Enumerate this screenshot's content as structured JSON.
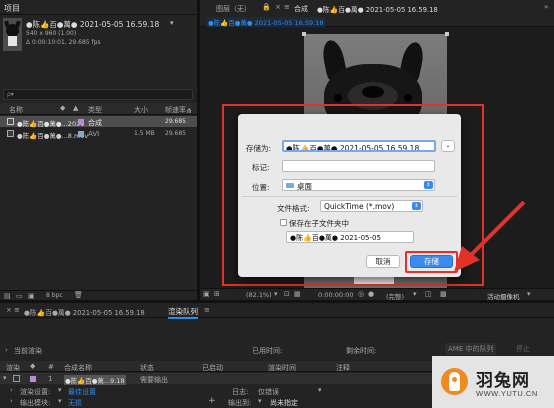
{
  "project_panel": {
    "tab_label": "项目",
    "comp_name": "●陈👍百●萬● 2021-05-05 16.59.18",
    "comp_name_arrow": "▾",
    "comp_info_size": "540 x 960 (1.00)",
    "comp_info_duration": "Δ 0:00:10:01, 29.685 fps",
    "search_placeholder": "ρ▾",
    "columns": {
      "name": "名称",
      "type": "类型",
      "size": "大小",
      "fps": "帧速率"
    },
    "items": [
      {
        "name": "●陈👍百●萬●...2021",
        "type": "合成",
        "size": "",
        "fps": "29.685"
      },
      {
        "name": "●陈👍百●萬●...8.mov",
        "type": "AVI",
        "size": "1.5 MB",
        "fps": "29.685"
      }
    ],
    "bpc": "8 bpc"
  },
  "viewer": {
    "tab_layer": "图层（无）",
    "tab_comp_prefix": "合成",
    "tab_comp_name": "●陈👍百●萬● 2021-05-05 16.59.18",
    "sub_tab": "●陈👍百●萬● 2021-05-05 16.59.18",
    "zoom": "(82.1%)",
    "timecode": "0:00:00:00",
    "resolution": "(完整)",
    "camera": "活动摄像机"
  },
  "save_dialog": {
    "save_as_label": "存储为:",
    "save_as_value": "●陈👍百●萬● 2021-05-05 16.59.18",
    "tags_label": "标记:",
    "tags_value": "",
    "location_label": "位置:",
    "location_value": "桌面",
    "format_label": "文件格式:",
    "format_value": "QuickTime (*.mov)",
    "subfolder_label": "保存在子文件夹中",
    "subfolder_value": "●陈👍百●萬● 2021-05-05",
    "cancel_label": "取消",
    "save_label": "存储",
    "accent_color": "#3b8af0",
    "highlight_color": "#e0312a"
  },
  "render_queue": {
    "tab_comp": "●陈👍百●萬● 2021-05-05 16.59.18",
    "tab_queue": "渲染队列",
    "current_render": "当前渲染",
    "elapsed": "已用时间:",
    "remaining": "剩余时间:",
    "ame_queue": "AME 中的队列",
    "stop": "停止",
    "columns": {
      "render": "渲染",
      "num": "#",
      "comp_name": "合成名称",
      "status": "状态",
      "started": "已启动",
      "render_time": "渲染时间",
      "notes": "注释"
    },
    "item_num": "1",
    "item_name": "●陈👍百●萬...9.18",
    "item_status": "需要输出",
    "render_settings_label": "渲染设置:",
    "render_settings_value": "最佳设置",
    "output_module_label": "输出模块:",
    "output_module_value": "无损",
    "log_label": "日志:",
    "log_value": "仅错误",
    "output_to_label": "输出到:",
    "output_to_value": "尚未指定"
  },
  "watermark": {
    "brand": "羽兔网",
    "url": "WWW.YUTU.CN"
  }
}
